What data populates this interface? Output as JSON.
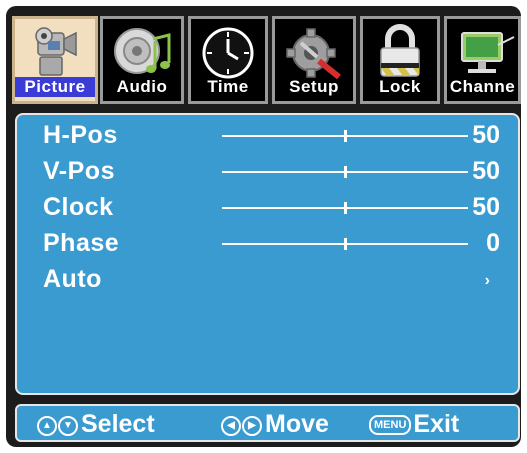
{
  "tabs": [
    {
      "label": "Picture",
      "icon": "camera-icon",
      "active": true
    },
    {
      "label": "Audio",
      "icon": "speaker-music-icon",
      "active": false
    },
    {
      "label": "Time",
      "icon": "clock-icon",
      "active": false
    },
    {
      "label": "Setup",
      "icon": "gear-tools-icon",
      "active": false
    },
    {
      "label": "Lock",
      "icon": "padlock-icon",
      "active": false
    },
    {
      "label": "Channe",
      "icon": "satellite-dish-icon",
      "active": false
    }
  ],
  "settings": [
    {
      "label": "H-Pos",
      "value": "50",
      "level": 0.5
    },
    {
      "label": "V-Pos",
      "value": "50",
      "level": 0.5
    },
    {
      "label": "Clock",
      "value": "50",
      "level": 0.5
    },
    {
      "label": "Phase",
      "value": "0",
      "level": 0.5
    },
    {
      "label": "Auto",
      "arrow": "›"
    }
  ],
  "footer": {
    "select_label": "Select",
    "move_label": "Move",
    "menu_key": "MENU",
    "exit_label": "Exit"
  },
  "colors": {
    "panel": "#3a9bd1",
    "active_tab": "#f2dfc0",
    "active_label_bg": "#3b3bd6"
  }
}
